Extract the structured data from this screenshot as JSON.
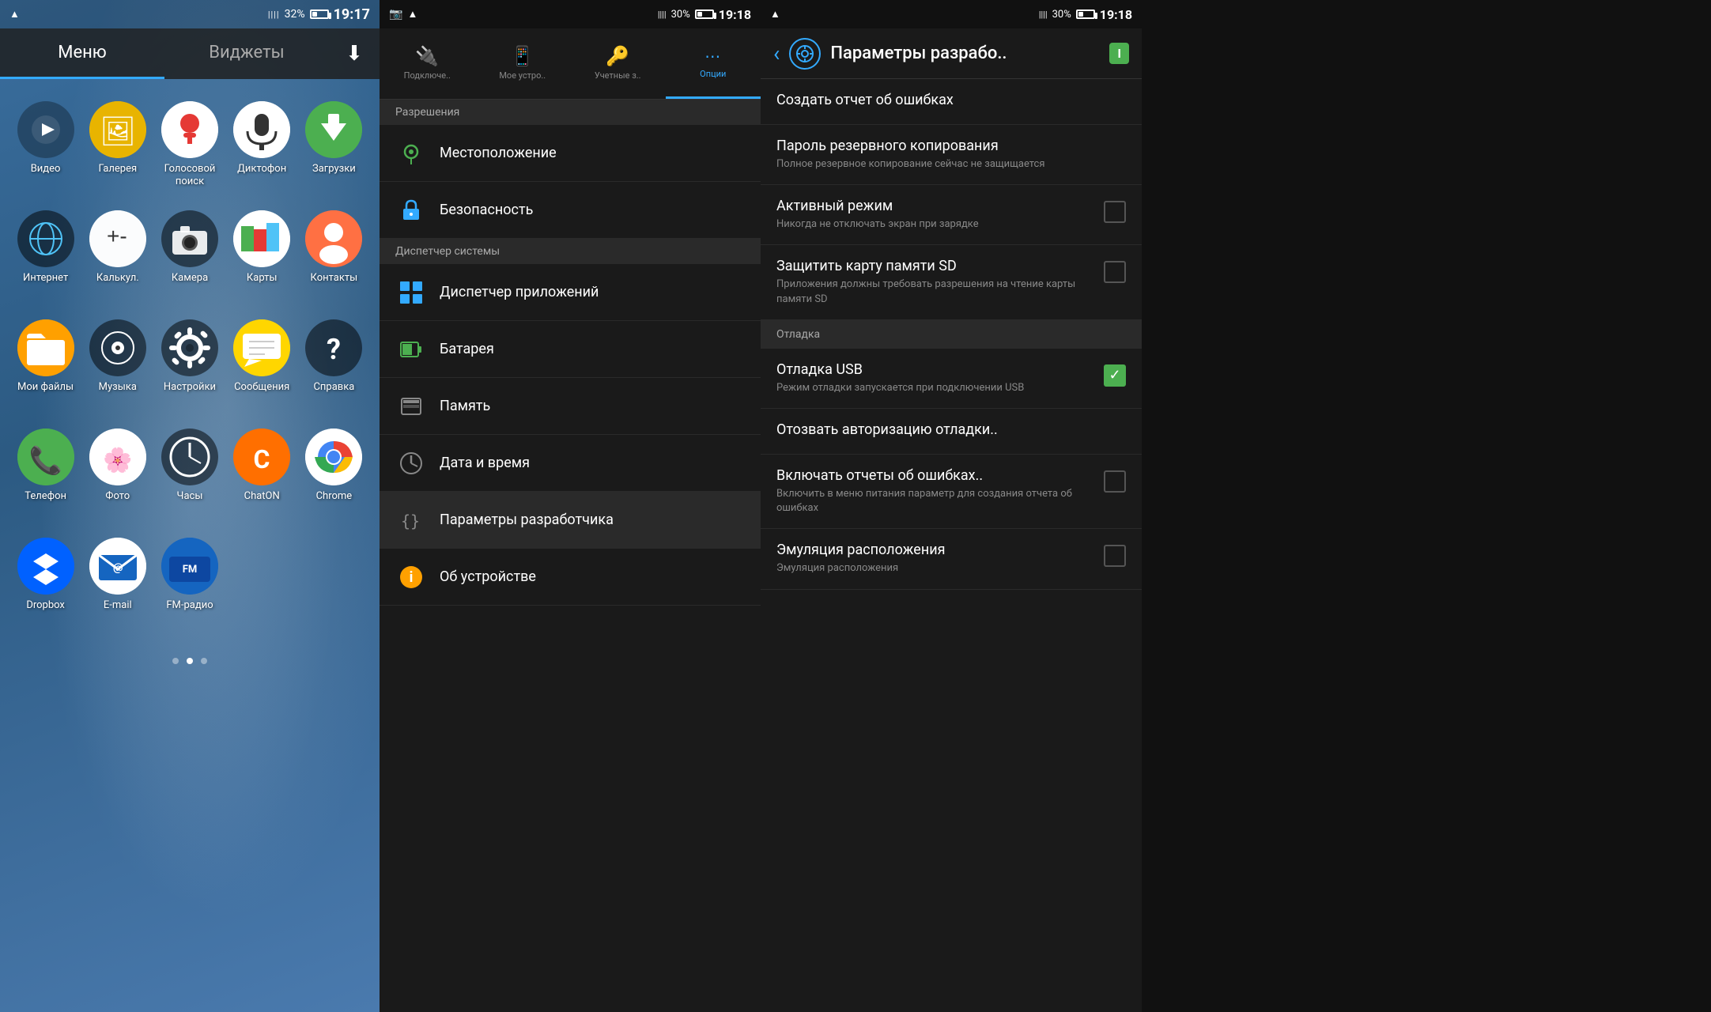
{
  "screen1": {
    "status": {
      "wifi": "▲",
      "signal": "||||",
      "battery_pct": "32%",
      "time": "19:17"
    },
    "tabs": [
      {
        "label": "Меню",
        "active": true
      },
      {
        "label": "Виджеты",
        "active": false
      }
    ],
    "download_icon": "⬇",
    "apps": [
      {
        "name": "Видео",
        "icon": "▶",
        "color": "#5a7a9e",
        "bg": "rgba(255,255,255,0.15)"
      },
      {
        "name": "Галерея",
        "icon": "🖼",
        "color": "#e8b400",
        "bg": "#e8b400"
      },
      {
        "name": "Голосовой поиск",
        "icon": "🎤",
        "color": "#e53935",
        "bg": "white"
      },
      {
        "name": "Диктофон",
        "icon": "🎙",
        "color": "#333",
        "bg": "white"
      },
      {
        "name": "Загрузки",
        "icon": "⬇",
        "color": "white",
        "bg": "#4CAF50"
      },
      {
        "name": "Интернет",
        "icon": "🌐",
        "color": "white",
        "bg": "rgba(255,255,255,0.15)"
      },
      {
        "name": "Калькул.",
        "icon": "±",
        "color": "#333",
        "bg": "rgba(255,255,255,0.85)"
      },
      {
        "name": "Камера",
        "icon": "📷",
        "color": "white",
        "bg": "rgba(255,255,255,0.15)"
      },
      {
        "name": "Карты",
        "icon": "🗺",
        "color": "white",
        "bg": "white"
      },
      {
        "name": "Контакты",
        "icon": "👤",
        "color": "white",
        "bg": "#FF7043"
      },
      {
        "name": "Мои файлы",
        "icon": "📁",
        "color": "white",
        "bg": "#FFA000"
      },
      {
        "name": "Музыка",
        "icon": "♪",
        "color": "white",
        "bg": "rgba(255,255,255,0.15)"
      },
      {
        "name": "Настройки",
        "icon": "⚙",
        "color": "white",
        "bg": "rgba(255,255,255,0.15)"
      },
      {
        "name": "Сообщения",
        "icon": "✉",
        "color": "#333",
        "bg": "#FFD600"
      },
      {
        "name": "Справка",
        "icon": "?",
        "color": "white",
        "bg": "rgba(255,255,255,0.15)"
      },
      {
        "name": "Телефон",
        "icon": "📞",
        "color": "white",
        "bg": "#4CAF50"
      },
      {
        "name": "Фото",
        "icon": "🌸",
        "color": "#333",
        "bg": "white"
      },
      {
        "name": "Часы",
        "icon": "🕐",
        "color": "white",
        "bg": "rgba(255,255,255,0.15)"
      },
      {
        "name": "ChatON",
        "icon": "C",
        "color": "white",
        "bg": "#FF6F00"
      },
      {
        "name": "Chrome",
        "icon": "◉",
        "color": "#333",
        "bg": "white"
      },
      {
        "name": "Dropbox",
        "icon": "📦",
        "color": "white",
        "bg": "#0061FF"
      },
      {
        "name": "E-mail",
        "icon": "@",
        "color": "#e53935",
        "bg": "white"
      },
      {
        "name": "FM-радио",
        "icon": "📻",
        "color": "white",
        "bg": "#1565C0"
      }
    ],
    "dots": [
      {
        "active": false
      },
      {
        "active": true
      },
      {
        "active": false
      }
    ]
  },
  "screen2": {
    "status": {
      "battery_pct": "30%",
      "time": "19:18"
    },
    "tabs": [
      {
        "label": "Подключе..",
        "icon": "🔌",
        "active": false
      },
      {
        "label": "Мое устро..",
        "icon": "📱",
        "active": false
      },
      {
        "label": "Учетные з..",
        "icon": "🔑",
        "active": false
      },
      {
        "label": "Опции",
        "icon": "⋯",
        "active": true
      }
    ],
    "section_header": "Разрешения",
    "items": [
      {
        "label": "Местоположение",
        "icon": "📍",
        "icon_color": "#4CAF50"
      },
      {
        "label": "Безопасность",
        "icon": "🔒",
        "icon_color": "#33aaff"
      },
      {
        "label": "Диспетчер системы",
        "icon": "",
        "is_header": true
      },
      {
        "label": "Диспетчер приложений",
        "icon": "▦",
        "icon_color": "#33aaff"
      },
      {
        "label": "Батарея",
        "icon": "🔋",
        "icon_color": "#4CAF50"
      },
      {
        "label": "Память",
        "icon": "💾",
        "icon_color": "#888"
      },
      {
        "label": "Дата и время",
        "icon": "🕐",
        "icon_color": "#888"
      },
      {
        "label": "Параметры разработчика",
        "icon": "{}",
        "icon_color": "#888"
      },
      {
        "label": "Об устройстве",
        "icon": "ℹ",
        "icon_color": "#FFA000"
      }
    ]
  },
  "screen3": {
    "status": {
      "battery_pct": "30%",
      "time": "19:18"
    },
    "toolbar": {
      "back_icon": "‹",
      "title": "Параметры разрабо..",
      "toggle_label": "I"
    },
    "items": [
      {
        "title": "Создать отчет об ошибках",
        "subtitle": "",
        "has_checkbox": false,
        "checked": false,
        "is_section": false
      },
      {
        "title": "Пароль резервного копирования",
        "subtitle": "Полное резервное копирование сейчас не защищается",
        "has_checkbox": false,
        "checked": false,
        "is_section": false
      },
      {
        "title": "Активный режим",
        "subtitle": "Никогда не отключать экран при зарядке",
        "has_checkbox": true,
        "checked": false,
        "is_section": false
      },
      {
        "title": "Защитить карту памяти SD",
        "subtitle": "Приложения должны требовать разрешения на чтение карты памяти SD",
        "has_checkbox": true,
        "checked": false,
        "is_section": false
      },
      {
        "title": "Отладка",
        "subtitle": "",
        "has_checkbox": false,
        "checked": false,
        "is_section": true
      },
      {
        "title": "Отладка USB",
        "subtitle": "Режим отладки запускается при подключении USB",
        "has_checkbox": true,
        "checked": true,
        "is_section": false
      },
      {
        "title": "Отозвать авторизацию отладки..",
        "subtitle": "",
        "has_checkbox": false,
        "checked": false,
        "is_section": false
      },
      {
        "title": "Включать отчеты об ошибках..",
        "subtitle": "Включить в меню питания параметр для создания отчета об ошибках",
        "has_checkbox": true,
        "checked": false,
        "is_section": false
      },
      {
        "title": "Эмуляция расположения",
        "subtitle": "Эмуляция расположения",
        "has_checkbox": true,
        "checked": false,
        "is_section": false
      }
    ]
  }
}
